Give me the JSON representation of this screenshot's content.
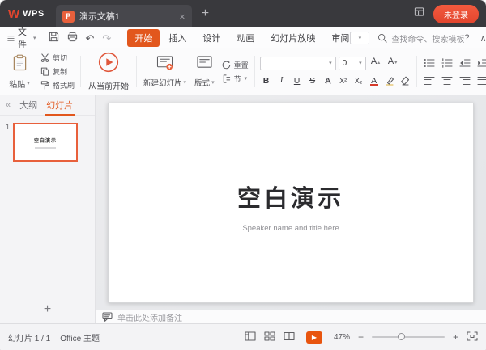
{
  "glyphs": {
    "logo_mark": "W",
    "close": "×",
    "plus": "+",
    "minus": "−",
    "caret_down": "▾",
    "caret_up": "▴",
    "collapse_left": "«",
    "chevron_up": "∧",
    "help": "?",
    "undo": "↶",
    "redo": "↷",
    "play": "▶"
  },
  "titlebar": {
    "app_name": "WPS",
    "doc_tab": {
      "icon_letter": "P",
      "title": "演示文稿1"
    },
    "login_label": "未登录"
  },
  "menubar": {
    "file_label": "文件",
    "tabs": [
      {
        "label": "开始",
        "active": true
      },
      {
        "label": "插入",
        "active": false
      },
      {
        "label": "设计",
        "active": false
      },
      {
        "label": "动画",
        "active": false
      },
      {
        "label": "幻灯片放映",
        "active": false
      },
      {
        "label": "审阅",
        "active": false
      }
    ],
    "search_placeholder": "查找命令、搜索模板"
  },
  "ribbon": {
    "paste_label": "粘贴",
    "cut_label": "剪切",
    "copy_label": "复制",
    "format_painter_label": "格式刷",
    "play_from_current_label": "从当前开始",
    "new_slide_label": "新建幻灯片",
    "layout_label": "版式",
    "reset_label": "重置",
    "section_label": "节",
    "font_family_value": "",
    "font_size_value": "0",
    "grow_font_label": "A",
    "shrink_font_label": "A",
    "bold_label": "B",
    "italic_label": "I",
    "underline_label": "U",
    "strikethrough_label": "S",
    "shadow_label": "A",
    "superscript_label": "X²",
    "subscript_label": "X₂",
    "font_color_label": "A"
  },
  "sidebar": {
    "tabs": [
      {
        "label": "大纲",
        "active": false
      },
      {
        "label": "幻灯片",
        "active": true
      }
    ],
    "slide_number": "1",
    "thumbnail_title": "空白演示"
  },
  "slide": {
    "title": "空白演示",
    "subtitle": "Speaker name and title here"
  },
  "notes_placeholder": "单击此处添加备注",
  "statusbar": {
    "slide_counter": "幻灯片 1 / 1",
    "theme_name": "Office 主题",
    "zoom_percent": "47%"
  },
  "colors": {
    "accent": "#e2571d",
    "login_red": "#e2452e",
    "titlebar_bg": "#39393d",
    "selection_border": "#e8603c",
    "canvas_bg": "#e7e9eb"
  }
}
